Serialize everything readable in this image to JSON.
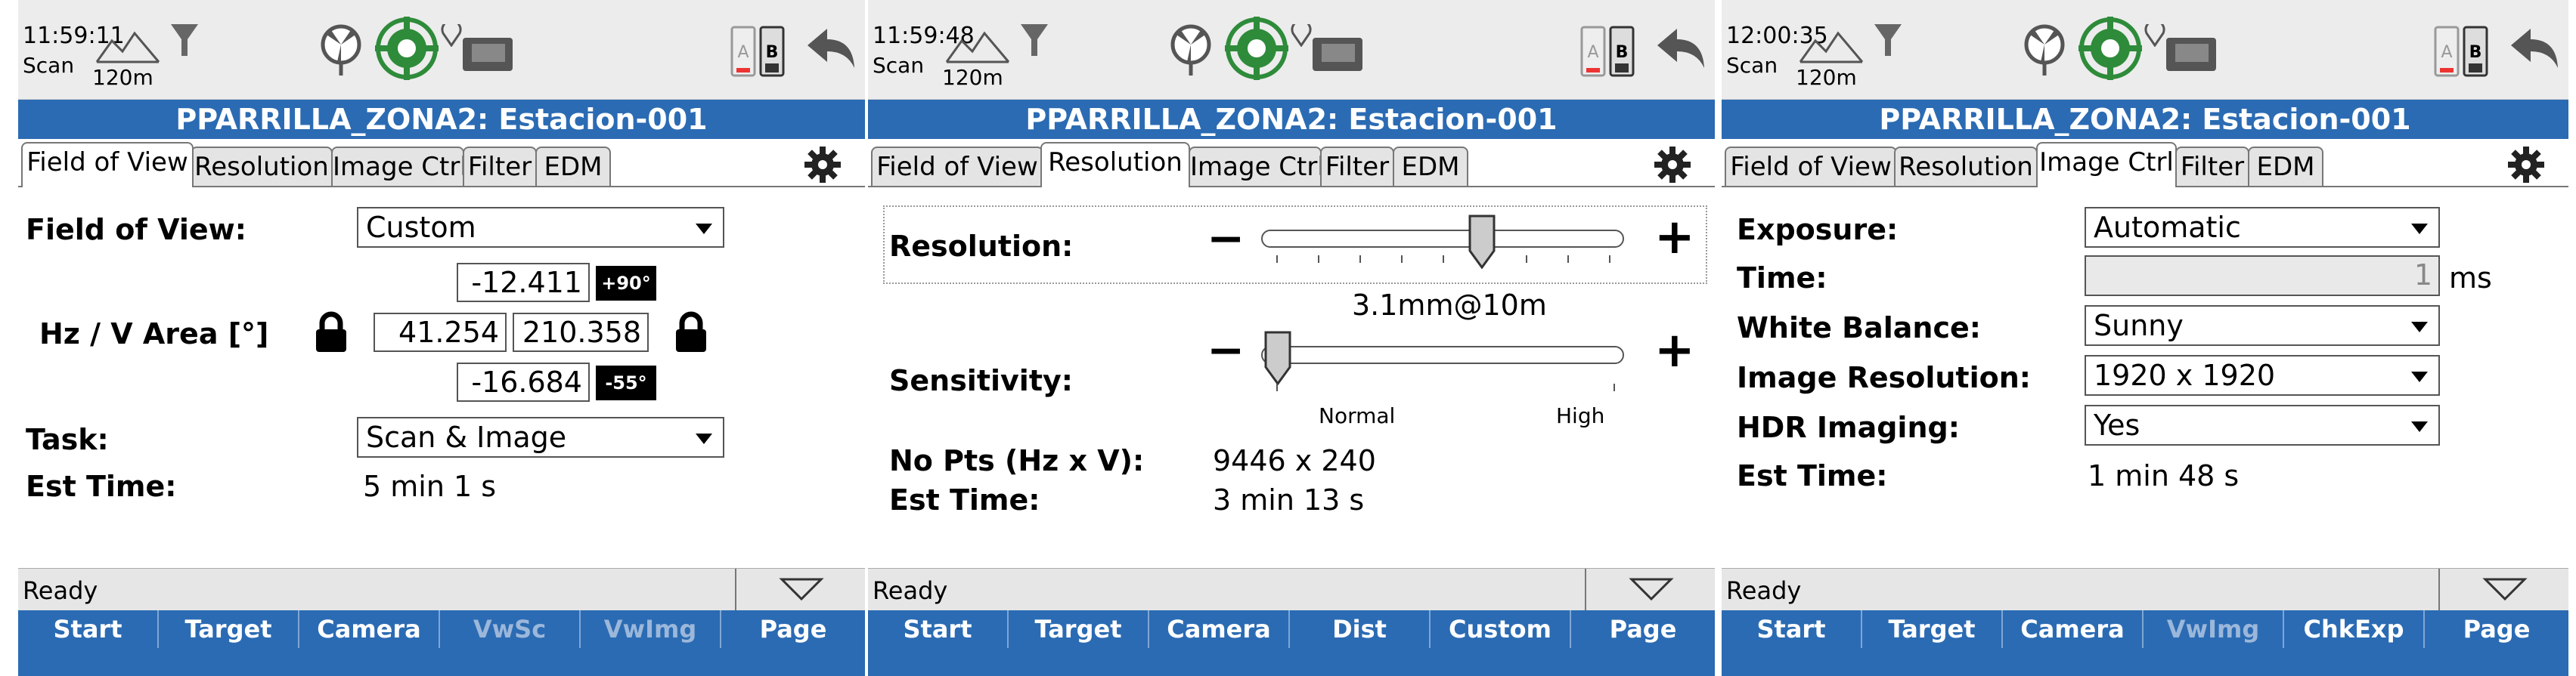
{
  "colors": {
    "title_bar": "#2b6bb3",
    "status_bar": "#ececec",
    "accent_green": "#2e8b3a",
    "badge": "#000000"
  },
  "screens": [
    {
      "status": {
        "clock": "11:59:11",
        "mode": "Scan",
        "range": "120m"
      },
      "title": "PPARRILLA_ZONA2: Estacion-001",
      "tabs": [
        "Field of View",
        "Resolution",
        "Image Ctrl",
        "Filter",
        "EDM"
      ],
      "active_tab": "Field of View",
      "fields": {
        "fov_label": "Field of View:",
        "fov_value": "Custom",
        "area_label": "Hz / V Area [°]",
        "v_top": "-12.411",
        "v_top_badge": "+90°",
        "hz_left": "41.254",
        "hz_right": "210.358",
        "v_bottom": "-16.684",
        "v_bottom_badge": "-55°",
        "task_label": "Task:",
        "task_value": "Scan & Image",
        "est_label": "Est Time:",
        "est_value": "5 min 1 s"
      },
      "ready": "Ready",
      "fkeys": [
        {
          "label": "Start",
          "enabled": true
        },
        {
          "label": "Target",
          "enabled": true
        },
        {
          "label": "Camera",
          "enabled": true
        },
        {
          "label": "VwSc",
          "enabled": false
        },
        {
          "label": "VwImg",
          "enabled": false
        },
        {
          "label": "Page",
          "enabled": true
        }
      ]
    },
    {
      "status": {
        "clock": "11:59:48",
        "mode": "Scan",
        "range": "120m"
      },
      "title": "PPARRILLA_ZONA2: Estacion-001",
      "tabs": [
        "Field of View",
        "Resolution",
        "Image Ctrl",
        "Filter",
        "EDM"
      ],
      "active_tab": "Resolution",
      "fields": {
        "res_label": "Resolution:",
        "res_value": "3.1mm@10m",
        "res_level": 0.62,
        "sens_label": "Sensitivity:",
        "sens_level": 0.0,
        "sens_min": "Normal",
        "sens_max": "High",
        "pts_label": "No Pts (Hz x V):",
        "pts_value": "9446 x 240",
        "est_label": "Est Time:",
        "est_value": "3 min 13 s"
      },
      "ready": "Ready",
      "fkeys": [
        {
          "label": "Start",
          "enabled": true
        },
        {
          "label": "Target",
          "enabled": true
        },
        {
          "label": "Camera",
          "enabled": true
        },
        {
          "label": "Dist",
          "enabled": true
        },
        {
          "label": "Custom",
          "enabled": true
        },
        {
          "label": "Page",
          "enabled": true
        }
      ]
    },
    {
      "status": {
        "clock": "12:00:35",
        "mode": "Scan",
        "range": "120m"
      },
      "title": "PPARRILLA_ZONA2: Estacion-001",
      "tabs": [
        "Field of View",
        "Resolution",
        "Image Ctrl",
        "Filter",
        "EDM"
      ],
      "active_tab": "Image Ctrl",
      "fields": {
        "exp_label": "Exposure:",
        "exp_value": "Automatic",
        "time_label": "Time:",
        "time_value": "1",
        "time_unit": "ms",
        "wb_label": "White Balance:",
        "wb_value": "Sunny",
        "imgres_label": "Image Resolution:",
        "imgres_value": "1920 x 1920",
        "hdr_label": "HDR Imaging:",
        "hdr_value": "Yes",
        "est_label": "Est Time:",
        "est_value": "1 min 48 s"
      },
      "ready": "Ready",
      "fkeys": [
        {
          "label": "Start",
          "enabled": true
        },
        {
          "label": "Target",
          "enabled": true
        },
        {
          "label": "Camera",
          "enabled": true
        },
        {
          "label": "VwImg",
          "enabled": false
        },
        {
          "label": "ChkExp",
          "enabled": true
        },
        {
          "label": "Page",
          "enabled": true
        }
      ]
    }
  ]
}
